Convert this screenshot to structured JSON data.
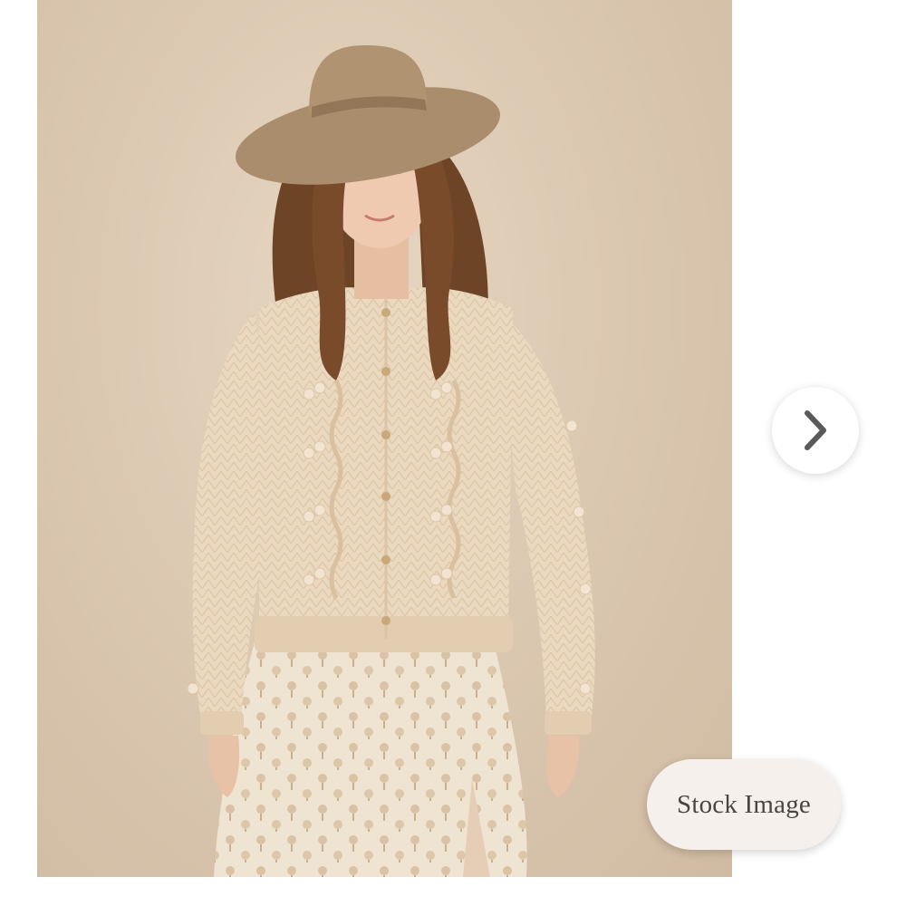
{
  "product_image": {
    "alt": "",
    "badge_label": "Stock Image"
  },
  "navigation": {
    "next_icon": "chevron-right-icon"
  },
  "colors": {
    "backdrop": "#d8c5ad",
    "hat": "#a98d6c",
    "cardigan": "#ead8bf",
    "skirt": "#efe2d0",
    "badge_background": "#f5f0ec",
    "badge_text": "#4a4540",
    "arrow": "#5a5a5a"
  }
}
